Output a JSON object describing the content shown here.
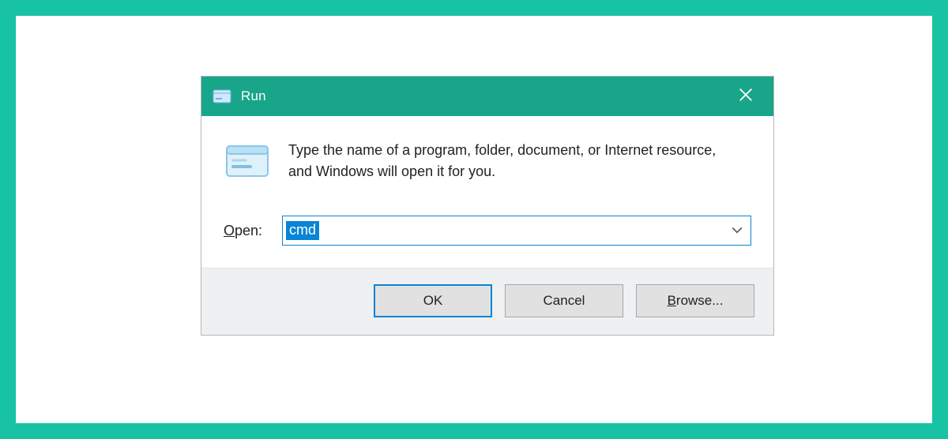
{
  "frame": {
    "accent": "#17c3a2"
  },
  "dialog": {
    "titlebar": {
      "title": "Run",
      "close_symbol": "✕"
    },
    "body": {
      "description": "Type the name of a program, folder, document, or Internet resource, and Windows will open it for you.",
      "open_label_pre": "O",
      "open_label_post": "pen:",
      "combo_value": "cmd"
    },
    "buttons": {
      "ok": "OK",
      "cancel": "Cancel",
      "browse_pre": "B",
      "browse_post": "rowse..."
    }
  }
}
